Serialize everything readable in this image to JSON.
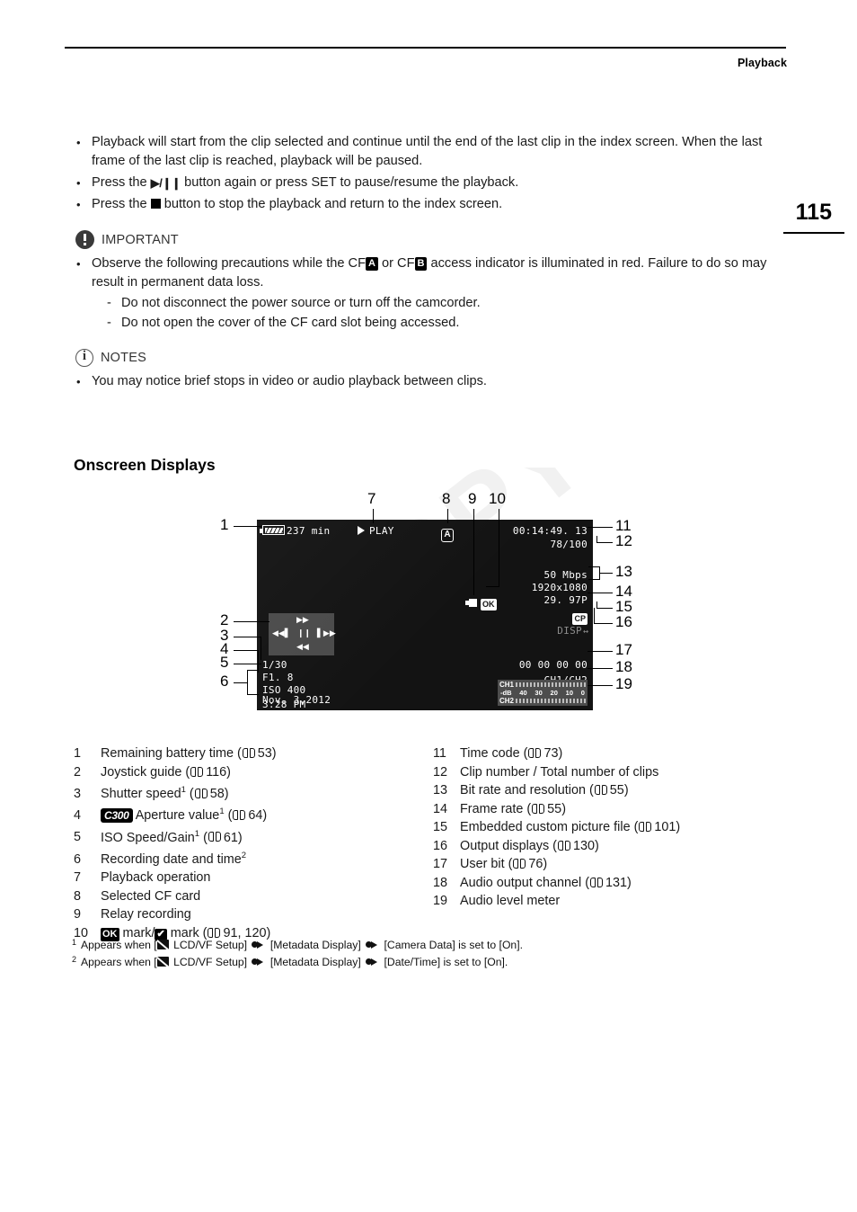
{
  "header": {
    "running_head": "Playback",
    "page_number": "115"
  },
  "intro_bullets": [
    {
      "parts": [
        "Playback will start from the clip selected and continue until the end of the last clip in the index screen. When the last frame of the last clip is reached, playback will be paused."
      ]
    },
    {
      "before": "Press the ",
      "glyph": "play-pause",
      "after": " button again or press SET to pause/resume the playback."
    },
    {
      "before": "Press the ",
      "glyph": "stop",
      "after": " button to stop the playback and return to the index screen."
    }
  ],
  "important": {
    "label": "IMPORTANT",
    "icon": "exclamation-circle-icon",
    "bullet_before": "Observe the following precautions while the CF",
    "card_a": "A",
    "bullet_mid": " or CF",
    "card_b": "B",
    "bullet_after": " access indicator is illuminated in red. Failure to do so may result in permanent data loss.",
    "sub_items": [
      "Do not disconnect the power source or turn off the camcorder.",
      "Do not open the cover of the CF card slot being accessed."
    ]
  },
  "notes": {
    "label": "NOTES",
    "icon": "info-circle-icon",
    "items": [
      "You may notice brief stops in video or audio playback between clips."
    ]
  },
  "section_heading": "Onscreen Displays",
  "watermark": "COPY",
  "screen": {
    "battery_time": "237 min",
    "playback_operation": "PLAY",
    "selected_cf_card": "A",
    "time_code": "00:14:49. 13",
    "clip_number": "78/100",
    "bit_rate": "50 Mbps",
    "resolution": "1920x1080",
    "frame_rate": "29. 97P",
    "custom_picture": "CP",
    "output_displays": "DISP",
    "output_displays_arrows": "↔",
    "ok_mark": "OK",
    "shutter_speed": "1/30",
    "aperture_value": "F1. 8",
    "iso_speed": "ISO 400",
    "rec_date": "Nov.  3,2012",
    "rec_time": "3:28 PM",
    "user_bit": "00 00 00 00",
    "audio_output_channel": "CH1/CH2",
    "joystick": {
      "up": "▶▶",
      "left": "◀◀▌",
      "middle": "❙❙",
      "right": "▌▶▶",
      "down": "◀◀"
    },
    "audio_meter": {
      "ch1_label": "CH1",
      "ch2_label": "CH2",
      "scale": [
        "-dB",
        "40",
        "30",
        "20",
        "10",
        "0"
      ]
    }
  },
  "callout_numbers_top": [
    "7",
    "8",
    "9",
    "10"
  ],
  "callout_numbers_left": [
    "1",
    "2",
    "3",
    "4",
    "5",
    "6"
  ],
  "callout_numbers_right": [
    "11",
    "12",
    "13",
    "14",
    "15",
    "16",
    "17",
    "18",
    "19"
  ],
  "legend_left": [
    {
      "idx": "1",
      "text": "Remaining battery time (",
      "page": "53",
      "tail": ")"
    },
    {
      "idx": "2",
      "text": "Joystick guide (",
      "page": "116",
      "tail": ")"
    },
    {
      "idx": "3",
      "text": "Shutter speed",
      "sup": "1",
      "text2": " (",
      "page": "58",
      "tail": ")"
    },
    {
      "idx": "4",
      "badge": "C300",
      "text": " Aperture value",
      "sup": "1",
      "text2": " (",
      "page": "64",
      "tail": ")"
    },
    {
      "idx": "5",
      "text": "ISO Speed/Gain",
      "sup": "1",
      "text2": " (",
      "page": "61",
      "tail": ")"
    },
    {
      "idx": "6",
      "text": "Recording date and time",
      "sup": "2"
    },
    {
      "idx": "7",
      "text": "Playback operation"
    },
    {
      "idx": "8",
      "text": "Selected CF card"
    },
    {
      "idx": "9",
      "text": "Relay recording"
    },
    {
      "idx": "10",
      "ok_badge": "OK",
      "text": " mark/",
      "check_badge": "✔",
      "text2": " mark (",
      "page": "91, 120",
      "tail": ")"
    }
  ],
  "legend_right": [
    {
      "idx": "11",
      "text": "Time code (",
      "page": "73",
      "tail": ")"
    },
    {
      "idx": "12",
      "text": "Clip number / Total number of clips"
    },
    {
      "idx": "13",
      "text": "Bit rate and resolution (",
      "page": "55",
      "tail": ")"
    },
    {
      "idx": "14",
      "text": "Frame rate (",
      "page": "55",
      "tail": ")"
    },
    {
      "idx": "15",
      "text": "Embedded custom picture file (",
      "page": "101",
      "tail": ")"
    },
    {
      "idx": "16",
      "text": "Output displays (",
      "page": "130",
      "tail": ")"
    },
    {
      "idx": "17",
      "text": "User bit (",
      "page": "76",
      "tail": ")"
    },
    {
      "idx": "18",
      "text": "Audio output channel (",
      "page": "131",
      "tail": ")"
    },
    {
      "idx": "19",
      "text": "Audio level meter"
    }
  ],
  "footnotes": [
    {
      "mark": "1",
      "p1": "Appears when [",
      "p2": " LCD/VF Setup] ",
      "p3": " [Metadata Display] ",
      "p4": " [Camera Data] is set to [On]."
    },
    {
      "mark": "2",
      "p1": "Appears when [",
      "p2": " LCD/VF Setup] ",
      "p3": " [Metadata Display] ",
      "p4": " [Date/Time] is set to [On]."
    }
  ]
}
